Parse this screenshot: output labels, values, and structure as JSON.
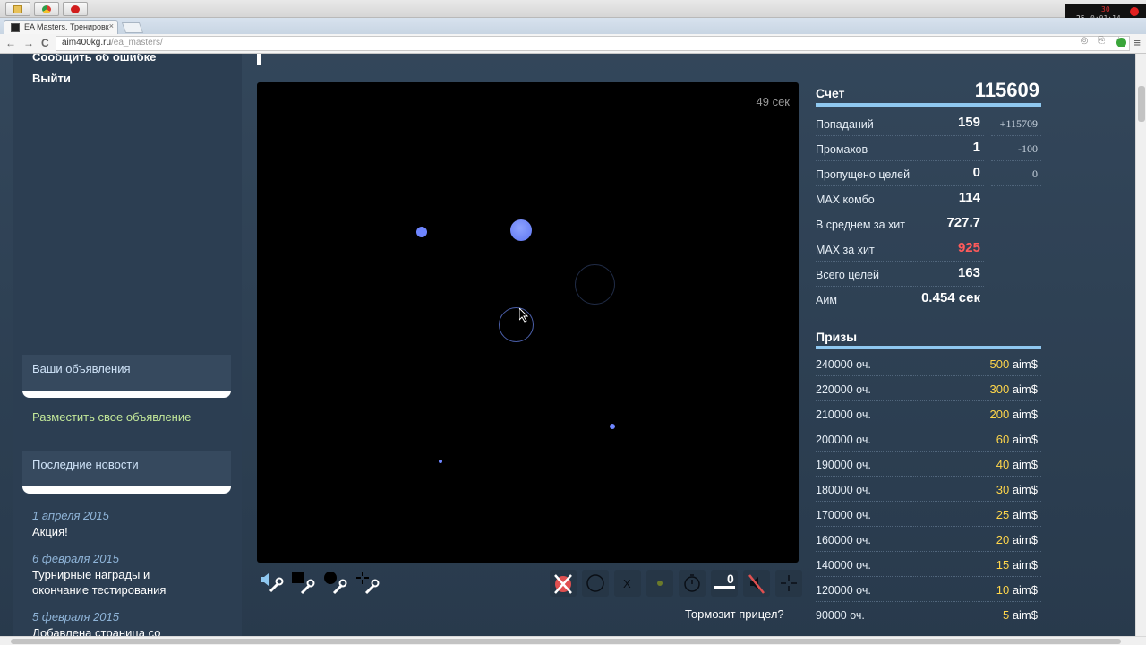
{
  "browser": {
    "tab_title": "EA Masters. Тренировк",
    "tab_close": "×",
    "url_host": "aim400kg.ru",
    "url_path": "/ea_masters/",
    "back": "←",
    "forward": "→",
    "reload": "C",
    "menu": "≡",
    "recorder": {
      "line1": "30",
      "line2": "25",
      "line3": "0:01:14"
    }
  },
  "sidebar": {
    "links": [
      "Сообщить об ошибке",
      "Выйти"
    ],
    "ads_title": "Ваши объявления",
    "ads_link": "Разместить свое объявление",
    "news_title": "Последние новости",
    "news": [
      {
        "date": "1 апреля 2015",
        "text": "Акция!"
      },
      {
        "date": "6 февраля 2015",
        "text_lines": [
          "Турнирные награды и",
          "окончание тестирования"
        ]
      },
      {
        "date": "5 февраля 2015",
        "text": "Добавлена страница со"
      }
    ]
  },
  "game": {
    "timer": "49 сек",
    "lag_link": "Тормозит прицел?",
    "combo_counter": "0",
    "x_label": "X"
  },
  "stats": {
    "score_label": "Счет",
    "score_value": "115609",
    "rows": [
      {
        "label": "Попаданий",
        "value": "159",
        "delta": "+115709"
      },
      {
        "label": "Промахов",
        "value": "1",
        "delta": "-100"
      },
      {
        "label": "Пропущено целей",
        "value": "0",
        "delta": "0"
      },
      {
        "label": "MAX комбо",
        "value": "114",
        "delta": ""
      },
      {
        "label": "В среднем за хит",
        "value": "727.7",
        "delta": ""
      },
      {
        "label": "MAX за хит",
        "value": "925",
        "delta": "",
        "highlight": "#ff5a5a"
      },
      {
        "label": "Всего целей",
        "value": "163",
        "delta": ""
      },
      {
        "label": "Аим",
        "value": "0.454 сек",
        "delta": ""
      }
    ],
    "prizes_title": "Призы",
    "prizes": [
      {
        "points": "240000 оч.",
        "amount": "500",
        "currency": "aim$"
      },
      {
        "points": "220000 оч.",
        "amount": "300",
        "currency": "aim$"
      },
      {
        "points": "210000 оч.",
        "amount": "200",
        "currency": "aim$"
      },
      {
        "points": "200000 оч.",
        "amount": "60",
        "currency": "aim$"
      },
      {
        "points": "190000 оч.",
        "amount": "40",
        "currency": "aim$"
      },
      {
        "points": "180000 оч.",
        "amount": "30",
        "currency": "aim$"
      },
      {
        "points": "170000 оч.",
        "amount": "25",
        "currency": "aim$"
      },
      {
        "points": "160000 оч.",
        "amount": "20",
        "currency": "aim$"
      },
      {
        "points": "140000 оч.",
        "amount": "15",
        "currency": "aim$"
      },
      {
        "points": "120000 оч.",
        "amount": "10",
        "currency": "aim$"
      },
      {
        "points": "90000 оч.",
        "amount": "5",
        "currency": "aim$"
      }
    ]
  },
  "colors": {
    "target_fill": "#6f86ff",
    "ring": "#3a4c8c",
    "prize_amount": "#ffd64a",
    "accent_bar": "#8fc8f0"
  }
}
